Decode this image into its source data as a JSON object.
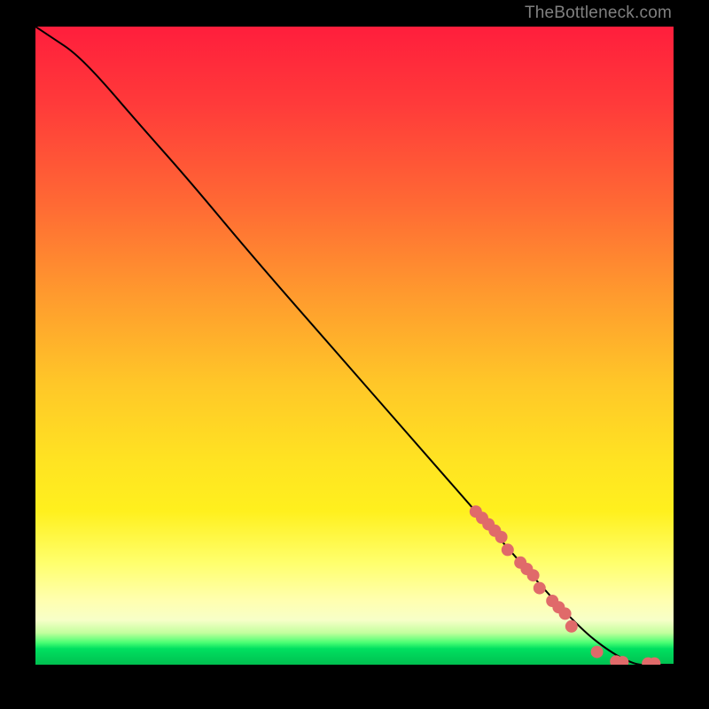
{
  "watermark": "TheBottleneck.com",
  "colors": {
    "frame_background": "#000000",
    "curve_stroke": "#000000",
    "marker_fill": "#e06a6a",
    "gradient_stops": [
      "#ff1e3c",
      "#ff3a3a",
      "#ff6a34",
      "#ff9a2e",
      "#ffc728",
      "#ffe322",
      "#fff01e",
      "#ffff6c",
      "#ffffb0",
      "#f7ffc8",
      "#c3ff9e",
      "#4dff74",
      "#00e060",
      "#00c050"
    ]
  },
  "chart_data": {
    "type": "line",
    "title": "",
    "xlabel": "",
    "ylabel": "",
    "xlim": [
      0,
      100
    ],
    "ylim": [
      0,
      100
    ],
    "grid": false,
    "legend": false,
    "series": [
      {
        "name": "bottleneck-curve",
        "x": [
          0,
          3,
          6,
          10,
          16,
          24,
          34,
          48,
          62,
          76,
          85,
          90,
          94,
          96,
          100
        ],
        "y": [
          100,
          98,
          96,
          92,
          85,
          76,
          64,
          48,
          32,
          16,
          6,
          2,
          0,
          0,
          0
        ]
      }
    ],
    "markers": [
      {
        "name": "highlighted-region-points",
        "x": [
          69,
          70,
          71,
          72,
          73,
          74,
          76,
          77,
          78,
          79,
          81,
          82,
          83,
          84,
          88,
          91,
          92,
          96,
          97
        ],
        "y": [
          24,
          23,
          22,
          21,
          20,
          18,
          16,
          15,
          14,
          12,
          10,
          9,
          8,
          6,
          2,
          0.5,
          0.4,
          0.2,
          0.2
        ]
      }
    ]
  }
}
